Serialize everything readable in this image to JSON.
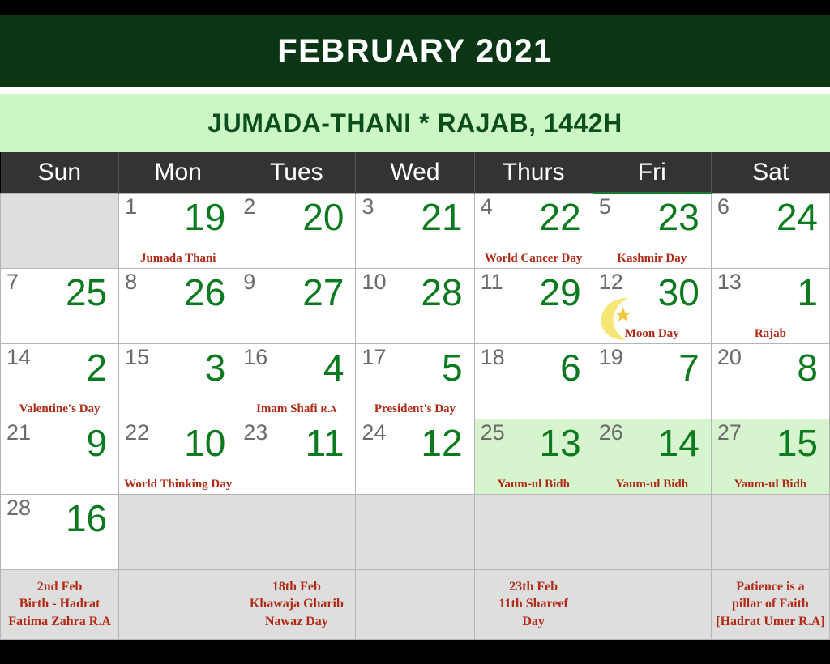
{
  "header": {
    "gregorian_month": "FEBRUARY 2021",
    "hijri_months": "JUMADA-THANI * RAJAB, 1442H",
    "banner_color": "#0b3616",
    "hijri_banner_color": "#ccf7c4"
  },
  "weekdays": [
    "Sun",
    "Mon",
    "Tues",
    "Wed",
    "Thurs",
    "Fri",
    "Sat"
  ],
  "colors": {
    "gregorian_number": "#6b6b6b",
    "hijri_number": "#0c7a1e",
    "event_text": "#b02a16",
    "highlight_cell": "#d6f5cf",
    "empty_cell": "#dedede",
    "friday_accent": "#1a7a2e",
    "moon_icon": "#f6e577"
  },
  "weeks": [
    [
      {
        "greg": "",
        "hij": "",
        "event": "",
        "empty": true
      },
      {
        "greg": "1",
        "hij": "19",
        "event": "Jumada Thani"
      },
      {
        "greg": "2",
        "hij": "20",
        "event": ""
      },
      {
        "greg": "3",
        "hij": "21",
        "event": ""
      },
      {
        "greg": "4",
        "hij": "22",
        "event": "World Cancer Day"
      },
      {
        "greg": "5",
        "hij": "23",
        "event": "Kashmir Day"
      },
      {
        "greg": "6",
        "hij": "24",
        "event": ""
      }
    ],
    [
      {
        "greg": "7",
        "hij": "25",
        "event": ""
      },
      {
        "greg": "8",
        "hij": "26",
        "event": ""
      },
      {
        "greg": "9",
        "hij": "27",
        "event": ""
      },
      {
        "greg": "10",
        "hij": "28",
        "event": ""
      },
      {
        "greg": "11",
        "hij": "29",
        "event": ""
      },
      {
        "greg": "12",
        "hij": "30",
        "event": "Moon Day",
        "icon": "crescent-moon-icon"
      },
      {
        "greg": "13",
        "hij": "1",
        "event": "Rajab"
      }
    ],
    [
      {
        "greg": "14",
        "hij": "2",
        "event": "Valentine's Day"
      },
      {
        "greg": "15",
        "hij": "3",
        "event": ""
      },
      {
        "greg": "16",
        "hij": "4",
        "event": "Imam Shafi R.A"
      },
      {
        "greg": "17",
        "hij": "5",
        "event": "President's Day"
      },
      {
        "greg": "18",
        "hij": "6",
        "event": ""
      },
      {
        "greg": "19",
        "hij": "7",
        "event": ""
      },
      {
        "greg": "20",
        "hij": "8",
        "event": ""
      }
    ],
    [
      {
        "greg": "21",
        "hij": "9",
        "event": ""
      },
      {
        "greg": "22",
        "hij": "10",
        "event": "World Thinking Day"
      },
      {
        "greg": "23",
        "hij": "11",
        "event": ""
      },
      {
        "greg": "24",
        "hij": "12",
        "event": ""
      },
      {
        "greg": "25",
        "hij": "13",
        "event": "Yaum-ul Bidh",
        "highlight": true
      },
      {
        "greg": "26",
        "hij": "14",
        "event": "Yaum-ul Bidh",
        "highlight": true
      },
      {
        "greg": "27",
        "hij": "15",
        "event": "Yaum-ul Bidh",
        "highlight": true
      }
    ],
    [
      {
        "greg": "28",
        "hij": "16",
        "event": ""
      },
      {
        "greg": "",
        "hij": "",
        "event": "",
        "empty": true
      },
      {
        "greg": "",
        "hij": "",
        "event": "",
        "empty": true
      },
      {
        "greg": "",
        "hij": "",
        "event": "",
        "empty": true
      },
      {
        "greg": "",
        "hij": "",
        "event": "",
        "empty": true
      },
      {
        "greg": "",
        "hij": "",
        "event": "",
        "empty": true
      },
      {
        "greg": "",
        "hij": "",
        "event": "",
        "empty": true
      }
    ]
  ],
  "footer_notes": [
    {
      "lines": [
        "2nd Feb",
        "Birth -  Hadrat",
        "Fatima Zahra R.A"
      ]
    },
    {
      "lines": []
    },
    {
      "lines": [
        "18th Feb",
        "Khawaja Gharib",
        "Nawaz Day"
      ]
    },
    {
      "lines": []
    },
    {
      "lines": [
        "23th Feb",
        "11th Shareef",
        "Day"
      ]
    },
    {
      "lines": []
    },
    {
      "lines": [
        "Patience is a",
        "pillar of Faith",
        "[Hadrat Umer R.A]"
      ]
    }
  ]
}
